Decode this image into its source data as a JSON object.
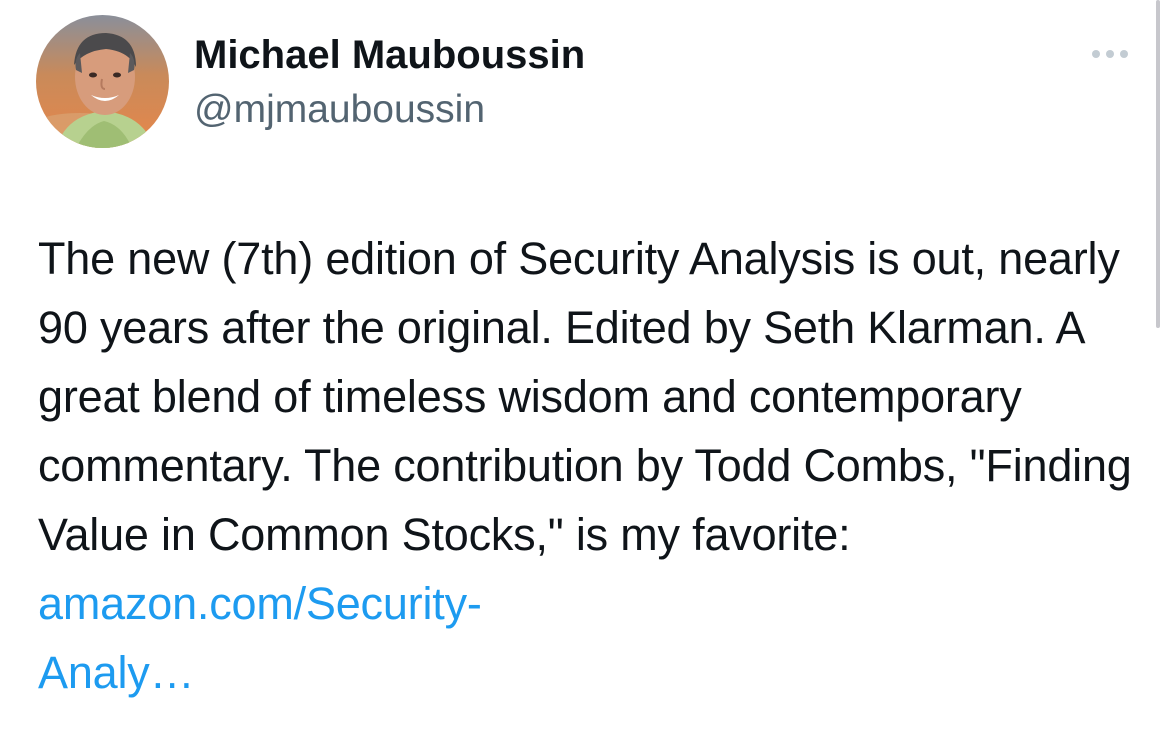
{
  "author": {
    "display_name": "Michael Mauboussin",
    "handle": "@mjmauboussin",
    "avatar_icon": "profile-photo-icon"
  },
  "more_button": {
    "icon": "more-options-icon"
  },
  "tweet": {
    "text": "The new (7th) edition of Security Analysis is out, nearly 90 years after the original. Edited by Seth Klarman. A great blend of timeless wisdom and contemporary commentary. The contribution by Todd Combs, \"Finding Value in Common Stocks,\" is my favorite: ",
    "link_part1": "amazon.com/Security-",
    "link_part2": "Analy…"
  },
  "colors": {
    "link": "#1d9bf0",
    "text": "#0f1419",
    "secondary": "#536471"
  }
}
